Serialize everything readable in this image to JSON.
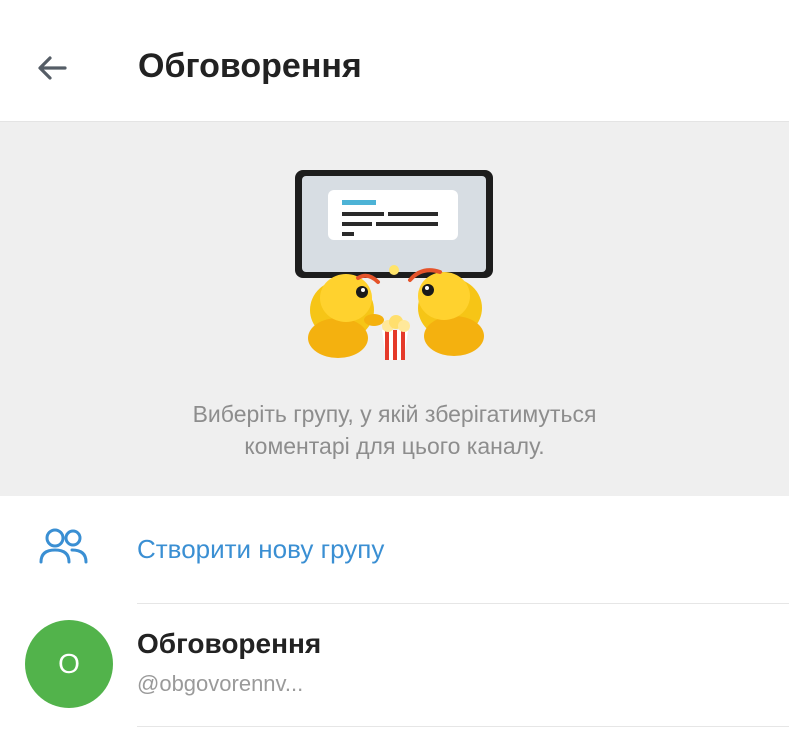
{
  "header": {
    "title": "Обговорення",
    "back_icon": "arrow-left-icon"
  },
  "info": {
    "illustration": "ducks-watching-screen-with-popcorn",
    "text_line1": "Виберіть групу, у якій зберігатимуться",
    "text_line2": "коментарі для цього каналу."
  },
  "create_group": {
    "icon": "people-icon",
    "label": "Створити нову групу"
  },
  "groups": [
    {
      "avatar_letter": "О",
      "name": "Обговорення",
      "handle": "@obgovorennv..."
    }
  ],
  "colors": {
    "accent": "#3a8fd3",
    "avatar": "#52b34b",
    "panel_bg": "#efefef",
    "muted_text": "#8d8d8d"
  }
}
